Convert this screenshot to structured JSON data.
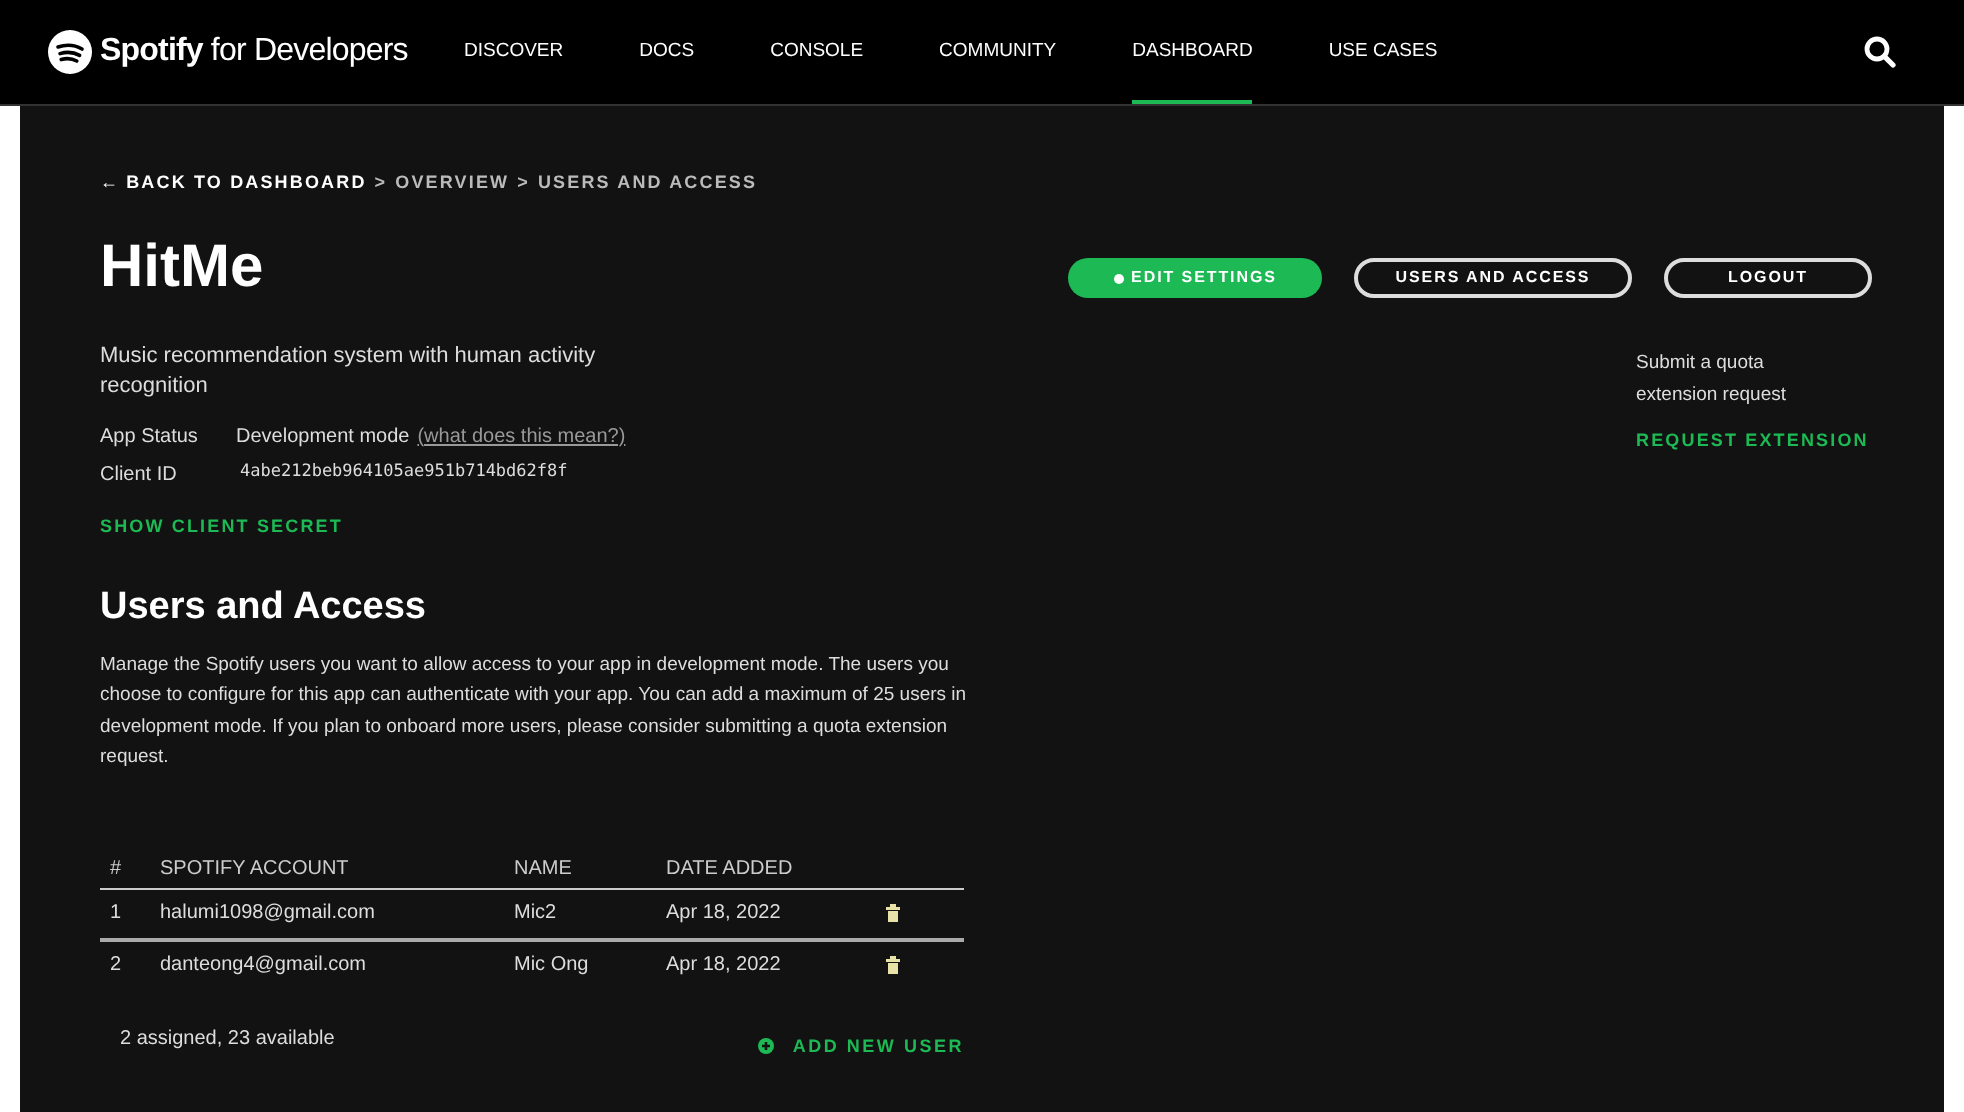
{
  "header": {
    "brand": "Spotify",
    "brand_suffix": "for Developers",
    "nav": [
      {
        "label": "DISCOVER",
        "selected": false
      },
      {
        "label": "DOCS",
        "selected": false
      },
      {
        "label": "CONSOLE",
        "selected": false
      },
      {
        "label": "COMMUNITY",
        "selected": false
      },
      {
        "label": "DASHBOARD",
        "selected": true
      },
      {
        "label": "USE CASES",
        "selected": false
      }
    ]
  },
  "breadcrumb": {
    "back_arrow": "←",
    "back": "BACK TO DASHBOARD",
    "separator": ">",
    "trail": [
      "OVERVIEW",
      "USERS AND ACCESS"
    ]
  },
  "app": {
    "name": "HitMe",
    "description": "Music recommendation system with human activity recognition",
    "status_label": "App Status",
    "status": "Development mode",
    "status_link": "(what does this mean?)",
    "client_id_label": "Client ID",
    "client_id": "4abe212beb964105ae951b714bd62f8f",
    "secret_link": "SHOW CLIENT SECRET"
  },
  "actions": [
    {
      "label": "EDIT SETTINGS",
      "kind": "primary"
    },
    {
      "label": "USERS AND ACCESS",
      "kind": "outline"
    },
    {
      "label": "LOGOUT",
      "kind": "outline"
    }
  ],
  "quota": {
    "text": "Submit a quota extension request",
    "link": "REQUEST EXTENSION"
  },
  "users": {
    "title": "Users and Access",
    "intro": "Manage the Spotify users you want to allow access to your app in development mode. The users you choose to configure for this app can authenticate with your app. You can add a maximum of 25 users in development mode. If you plan to onboard more users, please consider submitting a quota extension request.",
    "columns": [
      "#",
      "SPOTIFY ACCOUNT",
      "NAME",
      "DATE ADDED"
    ],
    "rows": [
      {
        "cells": [
          "1",
          "halumi1098@gmail.com",
          "Mic2",
          "Apr 18, 2022"
        ]
      },
      {
        "cells": [
          "2",
          "danteong4@gmail.com",
          "Mic Ong",
          "Apr 18, 2022"
        ]
      }
    ],
    "summary": "2 assigned, 23 available",
    "add_link": "ADD NEW USER"
  }
}
